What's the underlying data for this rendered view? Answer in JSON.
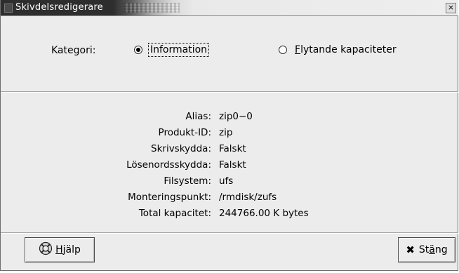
{
  "window": {
    "title": "Skivdelsredigerare",
    "close_glyph": "×"
  },
  "category": {
    "label": "Kategori:",
    "options": [
      {
        "mnemonic": "",
        "rest": "Information",
        "checked": true,
        "focused": true
      },
      {
        "mnemonic": "F",
        "rest": "lytande kapaciteter",
        "checked": false,
        "focused": false
      }
    ]
  },
  "info": {
    "rows": [
      {
        "key": "Alias:",
        "value": "zip0−0"
      },
      {
        "key": "Produkt-ID:",
        "value": "zip"
      },
      {
        "key": "Skrivskydda:",
        "value": "Falskt"
      },
      {
        "key": "Lösenordsskydda:",
        "value": "Falskt"
      },
      {
        "key": "Filsystem:",
        "value": "ufs"
      },
      {
        "key": "Monteringspunkt:",
        "value": "/rmdisk/zufs"
      },
      {
        "key": "Total kapacitet:",
        "value": "244766.00 K bytes"
      }
    ]
  },
  "buttons": {
    "help": {
      "mnemonic": "H",
      "rest": "jälp",
      "icon": "lifebuoy-icon"
    },
    "close": {
      "pre": "St",
      "mnemonic": "ä",
      "rest": "ng",
      "icon": "close-x-icon",
      "glyph": "✖"
    }
  }
}
